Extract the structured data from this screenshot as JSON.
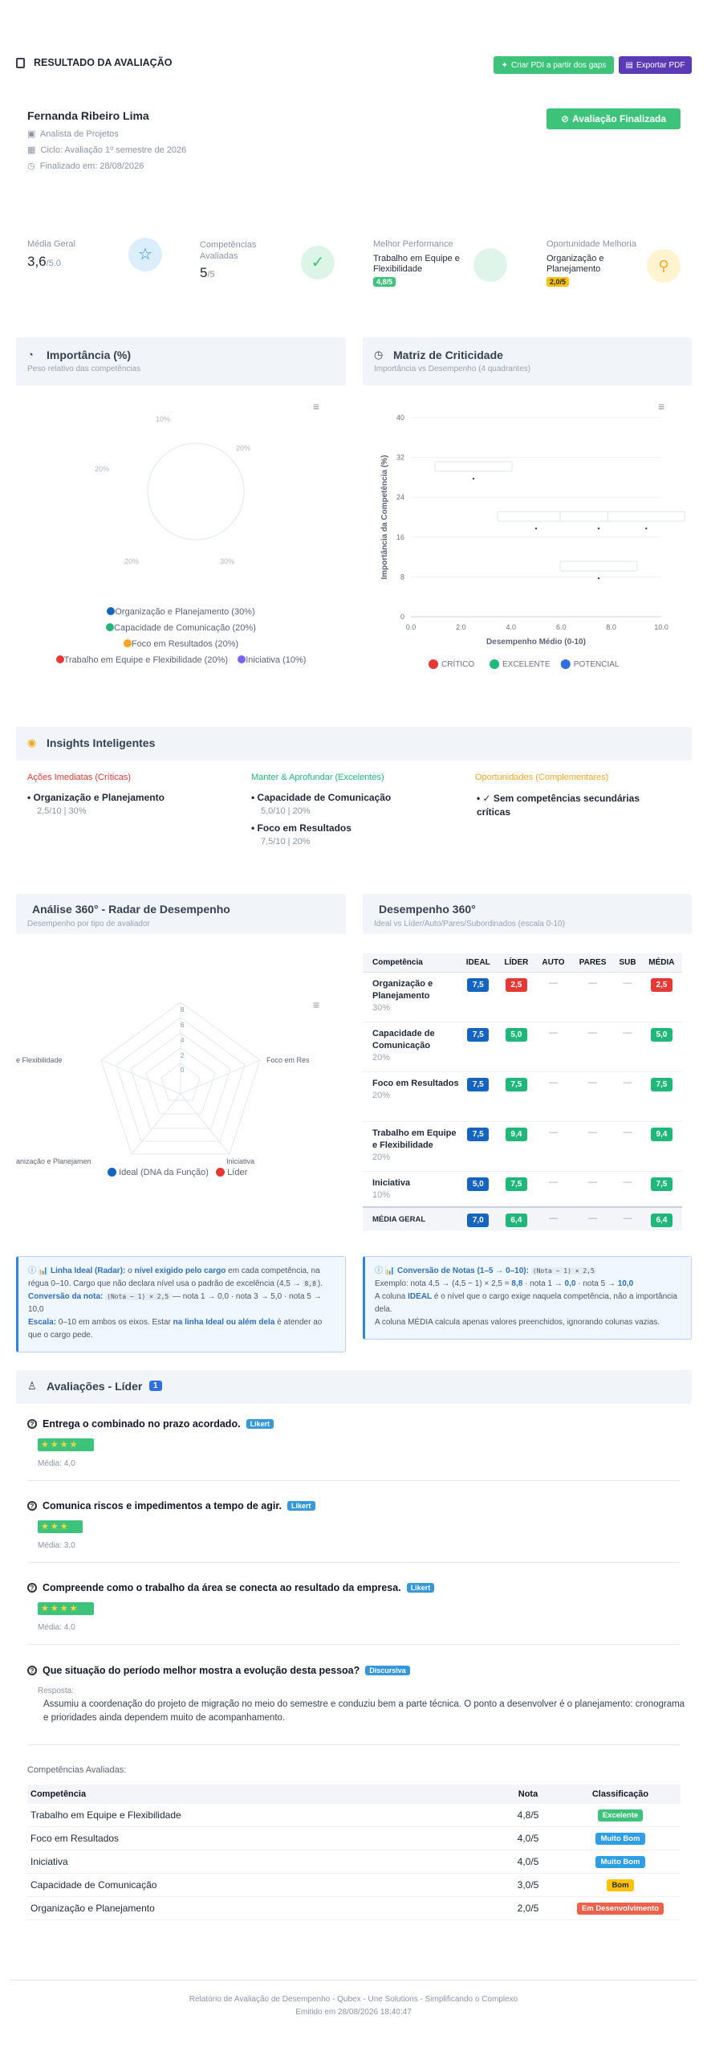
{
  "header": {
    "title": "RESULTADO DA AVALIAÇÃO",
    "btn_pdi": "Criar PDI a partir dos gaps",
    "btn_export": "Exportar PDF"
  },
  "employee": {
    "name": "Fernanda Ribeiro Lima",
    "role": "Analista de Projetos",
    "cycle": "Ciclo: Avaliação 1º semestre de 2026",
    "finished": "Finalizado em: 28/08/2026",
    "status": "Avaliação Finalizada"
  },
  "kpis": [
    {
      "label": "Média Geral",
      "value": "3,6",
      "suffix": "/5.0",
      "icon": "star-icon"
    },
    {
      "label": "Competências Avaliadas",
      "value": "5",
      "suffix": "/5",
      "icon": "check-circle-icon"
    },
    {
      "label": "Melhor Performance",
      "text": "Trabalho em Equipe e Flexibilidade",
      "badge": "4,8/5"
    },
    {
      "label": "Oportunidade Melhoria",
      "text": "Organização e Planejamento",
      "badge": "2,0/5",
      "icon": "lightbulb-icon"
    }
  ],
  "importance": {
    "title": "Importância (%)",
    "subtitle": "Peso relativo das competências",
    "labels": [
      "10%",
      "20%",
      "20%",
      "20%",
      "30%"
    ],
    "legend": [
      {
        "name": "Organização e Planejamento (30%)",
        "color": "#1565c0"
      },
      {
        "name": "Capacidade de Comunicação (20%)",
        "color": "#1fb87a"
      },
      {
        "name": "Foco em Resultados (20%)",
        "color": "#f5a623"
      },
      {
        "name": "Trabalho em Equipe e Flexibilidade (20%)",
        "color": "#e53935"
      },
      {
        "name": "Iniciativa (10%)",
        "color": "#7b61ff"
      }
    ]
  },
  "matrix": {
    "title": "Matriz de Criticidade",
    "subtitle": "Importância vs Desempenho (4 quadrantes)",
    "chart_data": {
      "type": "scatter",
      "xlabel": "Desempenho Médio (0-10)",
      "ylabel": "Importância da Competência (%)",
      "xlim": [
        0,
        10
      ],
      "ylim": [
        0,
        40
      ],
      "xticks": [
        "0.0",
        "2.0",
        "4.0",
        "6.0",
        "8.0",
        "10.0"
      ],
      "yticks": [
        "0",
        "8",
        "16",
        "24",
        "32",
        "40"
      ],
      "series": [
        {
          "name": "CRÍTICO",
          "color": "#e53935",
          "points": [
            [
              2.5,
              30
            ]
          ]
        },
        {
          "name": "EXCELENTE",
          "color": "#1fb87a",
          "points": [
            [
              5.0,
              20
            ],
            [
              7.5,
              20
            ],
            [
              9.4,
              20
            ]
          ]
        },
        {
          "name": "POTENCIAL",
          "color": "#2f6fe0",
          "points": [
            [
              7.5,
              10
            ]
          ]
        }
      ]
    }
  },
  "insights": {
    "title": "Insights Inteligentes",
    "columns": [
      {
        "heading": "Ações Imediatas (Críticas)",
        "color": "#e53935",
        "items": [
          {
            "name": "Organização e Planejamento",
            "meta": "2,5/10 | 30%"
          }
        ]
      },
      {
        "heading": "Manter & Aprofundar (Excelentes)",
        "color": "#1fb87a",
        "items": [
          {
            "name": "Capacidade de Comunicação",
            "meta": "5,0/10 | 20%"
          },
          {
            "name": "Foco em Resultados",
            "meta": "7,5/10 | 20%"
          }
        ]
      },
      {
        "heading": "Oportunidades (Complementares)",
        "color": "#f5a623",
        "items": [
          {
            "name": "✓ Sem competências secundárias críticas",
            "meta": ""
          }
        ]
      }
    ]
  },
  "radar": {
    "title": "Análise 360° - Radar de Desempenho",
    "subtitle": "Desempenho por tipo de avaliador",
    "axes": [
      "Foco em Res",
      "Iniciativa",
      "anização e Planejamen",
      "e Flexibilidade"
    ],
    "ticks": [
      "0",
      "2",
      "4",
      "6",
      "8"
    ],
    "legend": [
      {
        "name": "Ideal (DNA da Função)",
        "color": "#1565c0"
      },
      {
        "name": "Líder",
        "color": "#e53935"
      }
    ]
  },
  "perf360": {
    "title": "Desempenho 360°",
    "subtitle": "Ideal vs Líder/Auto/Pares/Subordinados (escala 0-10)",
    "columns": [
      "Competência",
      "IDEAL",
      "LÍDER",
      "AUTO",
      "PARES",
      "SUB",
      "MÉDIA"
    ],
    "rows": [
      {
        "name": "Organização e Planejamento",
        "weight": "30%",
        "ideal": "7,5",
        "lider": "2,5",
        "auto": "—",
        "pares": "—",
        "sub": "—",
        "media": "2,5",
        "lider_color": "#e53935",
        "media_color": "#e53935"
      },
      {
        "name": "Capacidade de Comunicação",
        "weight": "20%",
        "ideal": "7,5",
        "lider": "5,0",
        "auto": "—",
        "pares": "—",
        "sub": "—",
        "media": "5,0",
        "lider_color": "#1fb87a",
        "media_color": "#1fb87a"
      },
      {
        "name": "Foco em Resultados",
        "weight": "20%",
        "ideal": "7,5",
        "lider": "7,5",
        "auto": "—",
        "pares": "—",
        "sub": "—",
        "media": "7,5",
        "lider_color": "#1fb87a",
        "media_color": "#1fb87a"
      },
      {
        "name": "Trabalho em Equipe e Flexibilidade",
        "weight": "20%",
        "ideal": "7,5",
        "lider": "9,4",
        "auto": "—",
        "pares": "—",
        "sub": "—",
        "media": "9,4",
        "lider_color": "#1fb87a",
        "media_color": "#1fb87a"
      },
      {
        "name": "Iniciativa",
        "weight": "10%",
        "ideal": "5,0",
        "lider": "7,5",
        "auto": "—",
        "pares": "—",
        "sub": "—",
        "media": "7,5",
        "lider_color": "#1fb87a",
        "media_color": "#1fb87a"
      }
    ],
    "footer": {
      "name": "MÉDIA GERAL",
      "ideal": "7,0",
      "lider": "6,4",
      "auto": "—",
      "pares": "—",
      "sub": "—",
      "media": "6,4"
    }
  },
  "info_left": {
    "l1a": "📊 Linha Ideal (Radar):",
    "l1b": " o ",
    "l1c": "nível exigido pelo cargo",
    "l1d": " em cada competência, na régua 0–10. Cargo que não declara nível usa o padrão de excelência (4,5 → ",
    "l1e": "8,8",
    "l1f": ").",
    "l2a": "Conversão da nota:",
    "l2b": "(Nota − 1) × 2,5",
    "l2c": " — nota 1 → 0,0 · nota 3 → 5,0 · nota 5 → 10,0",
    "l3a": "Escala:",
    "l3b": " 0–10 em ambos os eixos. Estar ",
    "l3c": "na linha Ideal ou além dela",
    "l3d": " é atender ao que o cargo pede."
  },
  "info_right": {
    "l1a": "📊 Conversão de Notas (1–5 → 0–10):",
    "l1b": "(Nota − 1) × 2,5",
    "l2a": "Exemplo: nota 4,5 → (4,5 − 1) × 2,5 = ",
    "l2b": "8,8",
    "l2c": " · nota 1 → ",
    "l2d": "0,0",
    "l2e": " · nota 5 → ",
    "l2f": "10,0",
    "l3a": "A coluna ",
    "l3b": "IDEAL",
    "l3c": " é o nível que o cargo exige naquela competência, não a importância dela.",
    "l4": "A coluna MÉDIA calcula apenas valores preenchidos, ignorando colunas vazias."
  },
  "evaluations": {
    "title": "Avaliações - Líder",
    "count": "1",
    "questions": [
      {
        "text": "Entrega o combinado no prazo acordado.",
        "tag": "Likert",
        "stars": "★★★★",
        "media": "Média: 4,0"
      },
      {
        "text": "Comunica riscos e impedimentos a tempo de agir.",
        "tag": "Likert",
        "stars": "★★★",
        "media": "Média: 3,0"
      },
      {
        "text": "Compreende como o trabalho da área se conecta ao resultado da empresa.",
        "tag": "Likert",
        "stars": "★★★★",
        "media": "Média: 4,0"
      },
      {
        "text": "Que situação do período melhor mostra a evolução desta pessoa?",
        "tag": "Discursiva",
        "answer_label": "Resposta:",
        "answer": "Assumiu a coordenação do projeto de migração no meio do semestre e conduziu bem a parte técnica. O ponto a desenvolver é o planejamento: cronograma e prioridades ainda dependem muito de acompanhamento."
      }
    ]
  },
  "competencies": {
    "title": "Competências Avaliadas:",
    "headers": [
      "Competência",
      "Nota",
      "Classificação"
    ],
    "rows": [
      {
        "name": "Trabalho em Equipe e Flexibilidade",
        "score": "4,8/5",
        "class": "Excelente",
        "color": "#3ec47a",
        "text": "#ffffff"
      },
      {
        "name": "Foco em Resultados",
        "score": "4,0/5",
        "class": "Muito Bom",
        "color": "#2e9ee6",
        "text": "#ffffff"
      },
      {
        "name": "Iniciativa",
        "score": "4,0/5",
        "class": "Muito Bom",
        "color": "#2e9ee6",
        "text": "#ffffff"
      },
      {
        "name": "Capacidade de Comunicação",
        "score": "3,0/5",
        "class": "Bom",
        "color": "#ffc107",
        "text": "#1f2937"
      },
      {
        "name": "Organização e Planejamento",
        "score": "2,0/5",
        "class": "Em Desenvolvimento",
        "color": "#f0614b",
        "text": "#ffffff"
      }
    ]
  },
  "footer": {
    "line1": "Relatório de Avaliação de Desempenho - Qubex - Une Solutions - Simplificando o Complexo",
    "line2": "Emitido em 28/08/2026 18:40:47"
  }
}
